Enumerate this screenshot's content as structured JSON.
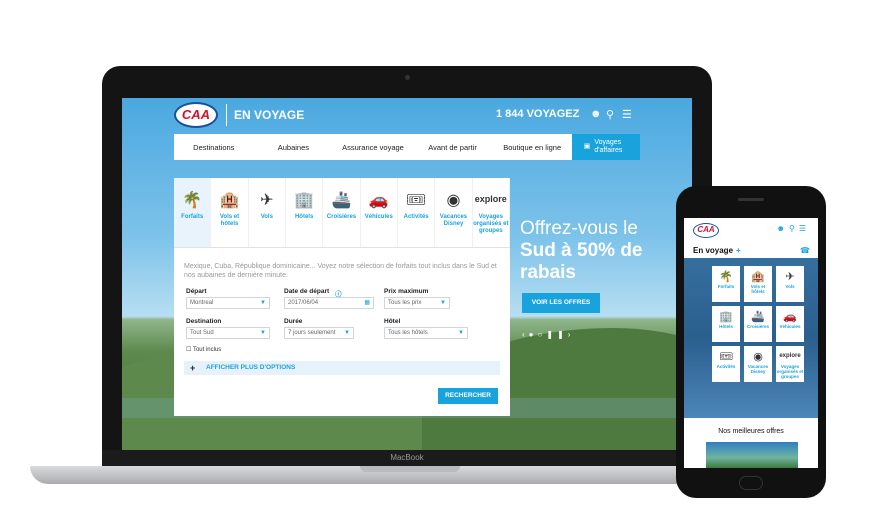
{
  "laptop": {
    "brand_label": "MacBook",
    "header": {
      "brand": "EN VOYAGE",
      "phone": "1 844 VOYAGEZ",
      "logo": "CAA"
    },
    "nav": {
      "items": [
        "Destinations",
        "Aubaines",
        "Assurance voyage",
        "Avant de partir",
        "Boutique en ligne"
      ],
      "business": "Voyages d'affaires"
    },
    "tabs": [
      {
        "label": "Forfaits",
        "icon": "palm-tree-icon"
      },
      {
        "label": "Vols et hôtels",
        "icon": "hotel-plane-icon"
      },
      {
        "label": "Vols",
        "icon": "plane-icon"
      },
      {
        "label": "Hôtels",
        "icon": "hotel-icon"
      },
      {
        "label": "Croisières",
        "icon": "cruise-icon"
      },
      {
        "label": "Véhicules",
        "icon": "car-icon"
      },
      {
        "label": "Activités",
        "icon": "tickets-icon"
      },
      {
        "label": "Vacances Disney",
        "icon": "disney-icon"
      },
      {
        "label": "Voyages organisés et groupes",
        "icon": "explore-icon"
      }
    ],
    "description": "Mexique, Cuba, République dominicaine... Voyez notre sélection de forfaits tout inclus dans le Sud et nos aubaines de dernière minute.",
    "form": {
      "depart_label": "Départ",
      "depart_value": "Montreal",
      "date_label": "Date de départ",
      "date_value": "2017/06/04",
      "price_label": "Prix maximum",
      "price_value": "Tous les prix",
      "dest_label": "Destination",
      "dest_value": "Tout Sud",
      "duree_label": "Durée",
      "duree_value": "7 jours seulement",
      "hotel_label": "Hôtel",
      "hotel_value": "Tous les hôtels",
      "tout_inclus": "Tout inclus",
      "more_options": "AFFICHER PLUS D'OPTIONS",
      "search": "RECHERCHER"
    },
    "hero": {
      "line1": "Offrez-vous le",
      "line2": "Sud à 50% de",
      "line3": "rabais",
      "button": "VOIR LES OFFRES"
    }
  },
  "phone": {
    "logo": "CAA",
    "section": "En voyage",
    "tiles": [
      {
        "label": "Forfaits",
        "icon": "palm-tree-icon"
      },
      {
        "label": "Vols et hôtels",
        "icon": "hotel-plane-icon"
      },
      {
        "label": "Vols",
        "icon": "plane-icon"
      },
      {
        "label": "Hôtels",
        "icon": "hotel-icon"
      },
      {
        "label": "Croisières",
        "icon": "cruise-icon"
      },
      {
        "label": "Véhicules",
        "icon": "car-icon"
      },
      {
        "label": "Activités",
        "icon": "tickets-icon"
      },
      {
        "label": "Vacances Disney",
        "icon": "disney-icon"
      },
      {
        "label": "Voyages organisés et groupes",
        "icon": "explore-icon"
      }
    ],
    "best_offers": "Nos meilleures offres"
  },
  "colors": {
    "accent": "#19a3dd",
    "logo_red": "#d0142c",
    "logo_blue": "#1a4f9e"
  }
}
